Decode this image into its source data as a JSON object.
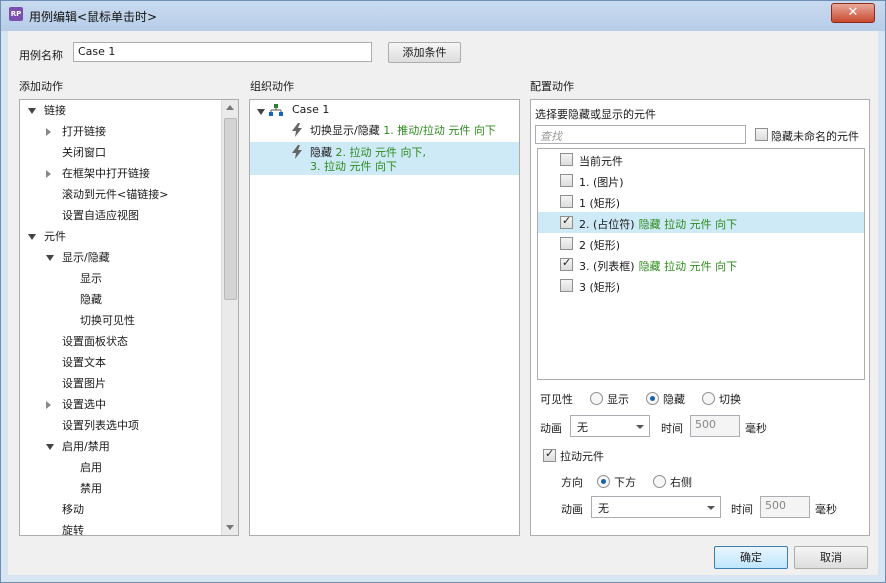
{
  "window": {
    "title": "用例编辑<鼠标单击时>",
    "app_icon": "RP",
    "close_symbol": "✕"
  },
  "case_name": {
    "label": "用例名称",
    "value": "Case 1",
    "add_condition": "添加条件"
  },
  "add_actions": {
    "header": "添加动作",
    "items": [
      {
        "label": "链接",
        "level": 0,
        "expander": "down"
      },
      {
        "label": "打开链接",
        "level": 1,
        "expander": "right"
      },
      {
        "label": "关闭窗口",
        "level": 1,
        "expander": "none"
      },
      {
        "label": "在框架中打开链接",
        "level": 1,
        "expander": "right"
      },
      {
        "label": "滚动到元件<锚链接>",
        "level": 1,
        "expander": "none"
      },
      {
        "label": "设置自适应视图",
        "level": 1,
        "expander": "none"
      },
      {
        "label": "元件",
        "level": 0,
        "expander": "down"
      },
      {
        "label": "显示/隐藏",
        "level": 1,
        "expander": "down"
      },
      {
        "label": "显示",
        "level": 2,
        "expander": "none"
      },
      {
        "label": "隐藏",
        "level": 2,
        "expander": "none"
      },
      {
        "label": "切换可见性",
        "level": 2,
        "expander": "none"
      },
      {
        "label": "设置面板状态",
        "level": 1,
        "expander": "none"
      },
      {
        "label": "设置文本",
        "level": 1,
        "expander": "none"
      },
      {
        "label": "设置图片",
        "level": 1,
        "expander": "none"
      },
      {
        "label": "设置选中",
        "level": 1,
        "expander": "right"
      },
      {
        "label": "设置列表选中项",
        "level": 1,
        "expander": "none"
      },
      {
        "label": "启用/禁用",
        "level": 1,
        "expander": "down"
      },
      {
        "label": "启用",
        "level": 2,
        "expander": "none"
      },
      {
        "label": "禁用",
        "level": 2,
        "expander": "none"
      },
      {
        "label": "移动",
        "level": 1,
        "expander": "none"
      },
      {
        "label": "旋转",
        "level": 1,
        "expander": "none"
      }
    ]
  },
  "organize": {
    "header": "组织动作",
    "case_label": "Case 1",
    "action1": {
      "verb": "切换显示/隐藏",
      "detail": "1. 推动/拉动 元件 向下"
    },
    "action2": {
      "verb": "隐藏",
      "detail_line1": "2. 拉动 元件 向下,",
      "detail_line2": "3. 拉动 元件 向下"
    }
  },
  "configure": {
    "header": "配置动作",
    "subtitle": "选择要隐藏或显示的元件",
    "search_placeholder": "查找",
    "hide_unnamed": "隐藏未命名的元件",
    "widgets": [
      {
        "label": "当前元件",
        "checked": false,
        "note": ""
      },
      {
        "label": "1. (图片)",
        "checked": false,
        "note": ""
      },
      {
        "label": "1 (矩形)",
        "checked": false,
        "note": ""
      },
      {
        "label": "2. (占位符)",
        "checked": true,
        "note": "隐藏 拉动 元件 向下"
      },
      {
        "label": "2 (矩形)",
        "checked": false,
        "note": ""
      },
      {
        "label": "3. (列表框)",
        "checked": true,
        "note": "隐藏 拉动 元件 向下"
      },
      {
        "label": "3 (矩形)",
        "checked": false,
        "note": ""
      }
    ],
    "visibility_label": "可见性",
    "visibility_options": [
      "显示",
      "隐藏",
      "切换"
    ],
    "visibility_selected": "隐藏",
    "animate_label": "动画",
    "animate_value": "无",
    "time_label": "时间",
    "time_value": "500",
    "ms_label": "毫秒",
    "pull_widgets_label": "拉动元件",
    "pull_checked": true,
    "direction_label": "方向",
    "direction_options": [
      "下方",
      "右侧"
    ],
    "direction_selected": "下方",
    "pull_animate_label": "动画",
    "pull_animate_value": "无",
    "pull_time_label": "时间",
    "pull_time_value": "500",
    "pull_ms_label": "毫秒"
  },
  "footer": {
    "ok": "确定",
    "cancel": "取消"
  }
}
